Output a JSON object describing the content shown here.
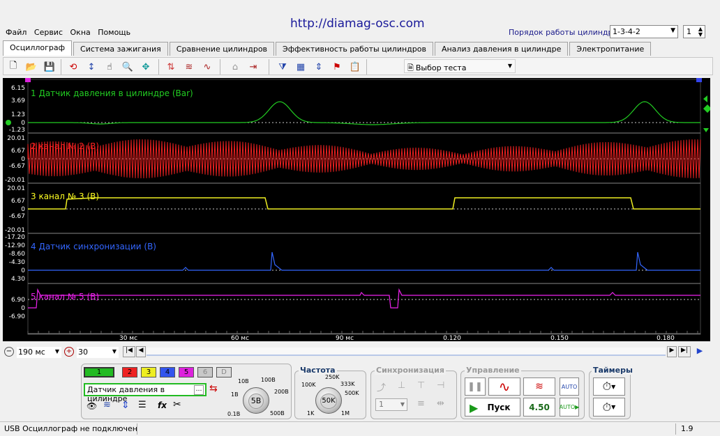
{
  "menu": [
    "Файл",
    "Сервис",
    "Окна",
    "Помощь"
  ],
  "url": "http://diamag-osc.com",
  "cyl_order_label": "Порядок работы цилиндров",
  "cyl_order_value": "1-3-4-2",
  "cyl_spin_value": "1",
  "tabs": [
    "Осциллограф",
    "Система зажигания",
    "Сравнение цилиндров",
    "Эффективность работы цилиндров",
    "Анализ давления в цилиндре",
    "Электропитание"
  ],
  "test_select": "Выбор теста",
  "marker_left": "1",
  "marker_right": "2",
  "channels": [
    {
      "label": "1 Датчик давления в цилиндре (Bar)",
      "color": "#22cc22",
      "ticks": [
        "6.15",
        "3.69",
        "1.23",
        "0",
        "-1.23"
      ]
    },
    {
      "label": "2 канал № 2 (В)",
      "color": "#ff2020",
      "ticks": [
        "20.01",
        "6.67",
        "0",
        "-6.67",
        "-20.01"
      ]
    },
    {
      "label": "3 канал № 3 (В)",
      "color": "#ffff22",
      "ticks": [
        "20.01",
        "6.67",
        "0",
        "-6.67",
        "-20.01"
      ]
    },
    {
      "label": "4 Датчик синхронизации (В)",
      "color": "#3366ff",
      "ticks": [
        "-17.20",
        "-12.90",
        "-8.60",
        "-4.30",
        "0",
        "4.30"
      ]
    },
    {
      "label": "5 канал № 5 (В)",
      "color": "#ee22ee",
      "ticks": [
        "6.90",
        "0",
        "-6.90"
      ]
    }
  ],
  "x_ticks": [
    "30 мс",
    "60 мс",
    "90 мс",
    "0.120",
    "0.150",
    "0.180"
  ],
  "timebase": "190 мс",
  "zoom": "30",
  "channel_buttons": [
    {
      "label": "1",
      "color": "#22bb22"
    },
    {
      "label": "2",
      "color": "#ee2222"
    },
    {
      "label": "3",
      "color": "#eeee22"
    },
    {
      "label": "4",
      "color": "#3355ee"
    },
    {
      "label": "5",
      "color": "#dd22dd"
    },
    {
      "label": "6",
      "color": "#c8c8c8"
    },
    {
      "label": "D",
      "color": "#dcdcdc"
    }
  ],
  "channel_sensor": "Датчик давления в цилиндре",
  "volt_knob": {
    "value": "5В",
    "labels": [
      "10В",
      "100В",
      "1В",
      "200В",
      "0.1В",
      "500В"
    ]
  },
  "freq_title": "Частота",
  "freq_knob": {
    "value": "50K",
    "labels": [
      "250K",
      "100K",
      "333K",
      "500K",
      "1K",
      "1M"
    ]
  },
  "sync_title": "Синхронизация",
  "sync_value": "1",
  "control_title": "Управление",
  "start_label": "Пуск",
  "control_value": "4.50",
  "timers_title": "Таймеры",
  "status_text": "USB Осциллограф не подключен",
  "version": "1.9"
}
